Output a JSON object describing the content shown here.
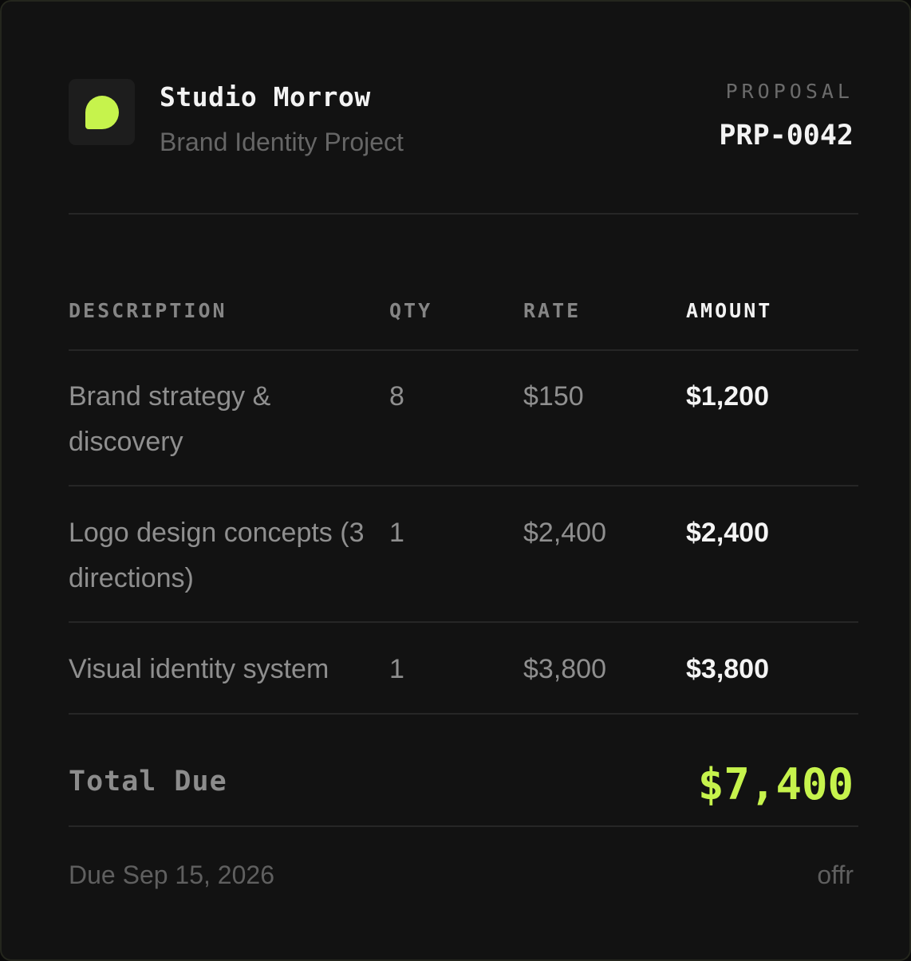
{
  "header": {
    "studio_name": "Studio Morrow",
    "project_name": "Brand Identity Project",
    "document_type": "PROPOSAL",
    "document_number": "PRP-0042"
  },
  "table": {
    "columns": [
      "DESCRIPTION",
      "QTY",
      "RATE",
      "AMOUNT"
    ],
    "rows": [
      {
        "description": "Brand strategy & discovery",
        "qty": "8",
        "rate": "$150",
        "amount": "$1,200"
      },
      {
        "description": "Logo design concepts (3 directions)",
        "qty": "1",
        "rate": "$2,400",
        "amount": "$2,400"
      },
      {
        "description": "Visual identity system",
        "qty": "1",
        "rate": "$3,800",
        "amount": "$3,800"
      }
    ]
  },
  "total": {
    "label": "Total Due",
    "value": "$7,400"
  },
  "footer": {
    "due_date": "Due Sep 15, 2026",
    "brand_mark": "offr"
  },
  "colors": {
    "accent": "#c6f34c",
    "background": "#121212",
    "text_primary": "#f3f3f3",
    "text_muted": "#8f8f8f"
  },
  "icons": {
    "logo": "leaf-blob-icon"
  }
}
